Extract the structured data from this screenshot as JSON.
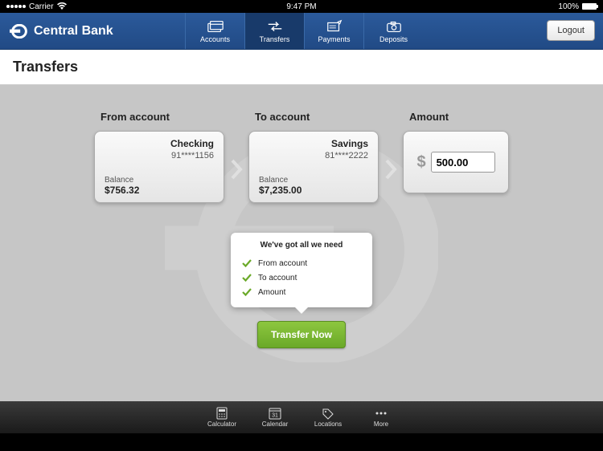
{
  "status": {
    "carrier": "Carrier",
    "time": "9:47 PM",
    "battery": "100%"
  },
  "brand": {
    "name": "Central Bank"
  },
  "nav": {
    "tabs": [
      {
        "label": "Accounts"
      },
      {
        "label": "Transfers"
      },
      {
        "label": "Payments"
      },
      {
        "label": "Deposits"
      }
    ],
    "logout": "Logout"
  },
  "page": {
    "title": "Transfers"
  },
  "transfer": {
    "from_label": "From account",
    "to_label": "To account",
    "amount_label": "Amount",
    "from": {
      "name": "Checking",
      "number": "91****1156",
      "balance_label": "Balance",
      "balance": "$756.32"
    },
    "to": {
      "name": "Savings",
      "number": "81****2222",
      "balance_label": "Balance",
      "balance": "$7,235.00"
    },
    "amount": {
      "value": "500.00",
      "currency": "$"
    },
    "button": "Transfer Now"
  },
  "popup": {
    "title": "We've got all we need",
    "items": [
      "From account",
      "To account",
      "Amount"
    ]
  },
  "bottom": {
    "items": [
      {
        "label": "Calculator"
      },
      {
        "label": "Calendar",
        "day": "31"
      },
      {
        "label": "Locations"
      },
      {
        "label": "More"
      }
    ]
  }
}
